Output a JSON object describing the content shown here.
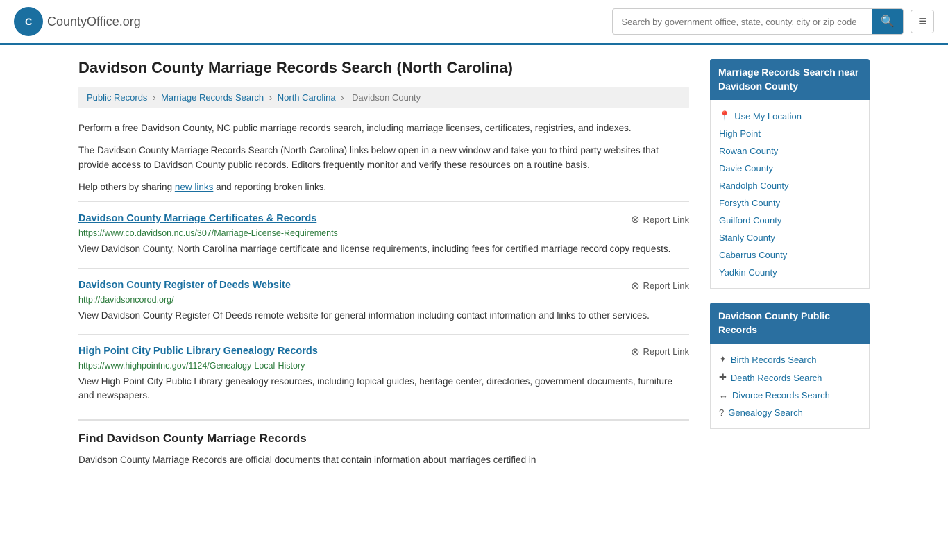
{
  "header": {
    "logo_text": "CountyOffice",
    "logo_ext": ".org",
    "search_placeholder": "Search by government office, state, county, city or zip code",
    "menu_icon": "≡"
  },
  "page": {
    "title": "Davidson County Marriage Records Search (North Carolina)"
  },
  "breadcrumb": {
    "items": [
      "Public Records",
      "Marriage Records Search",
      "North Carolina",
      "Davidson County"
    ]
  },
  "description": {
    "p1": "Perform a free Davidson County, NC public marriage records search, including marriage licenses, certificates, registries, and indexes.",
    "p2": "The Davidson County Marriage Records Search (North Carolina) links below open in a new window and take you to third party websites that provide access to Davidson County public records. Editors frequently monitor and verify these resources on a routine basis.",
    "p3_before": "Help others by sharing ",
    "p3_link": "new links",
    "p3_after": " and reporting broken links."
  },
  "records": [
    {
      "title": "Davidson County Marriage Certificates & Records",
      "url": "https://www.co.davidson.nc.us/307/Marriage-License-Requirements",
      "description": "View Davidson County, North Carolina marriage certificate and license requirements, including fees for certified marriage record copy requests.",
      "report_label": "Report Link"
    },
    {
      "title": "Davidson County Register of Deeds Website",
      "url": "http://davidsoncorod.org/",
      "description": "View Davidson County Register Of Deeds remote website for general information including contact information and links to other services.",
      "report_label": "Report Link"
    },
    {
      "title": "High Point City Public Library Genealogy Records",
      "url": "https://www.highpointnc.gov/1124/Genealogy-Local-History",
      "description": "View High Point City Public Library genealogy resources, including topical guides, heritage center, directories, government documents, furniture and newspapers.",
      "report_label": "Report Link"
    }
  ],
  "find_section": {
    "heading": "Find Davidson County Marriage Records",
    "text": "Davidson County Marriage Records are official documents that contain information about marriages certified in"
  },
  "sidebar": {
    "box1": {
      "title": "Marriage Records Search near Davidson County",
      "use_my_location": "Use My Location",
      "links": [
        "High Point",
        "Rowan County",
        "Davie County",
        "Randolph County",
        "Forsyth County",
        "Guilford County",
        "Stanly County",
        "Cabarrus County",
        "Yadkin County"
      ]
    },
    "box2": {
      "title": "Davidson County Public Records",
      "links": [
        {
          "label": "Birth Records Search",
          "icon": "✦"
        },
        {
          "label": "Death Records Search",
          "icon": "✚"
        },
        {
          "label": "Divorce Records Search",
          "icon": "↔"
        },
        {
          "label": "Genealogy Search",
          "icon": "?"
        }
      ]
    }
  }
}
